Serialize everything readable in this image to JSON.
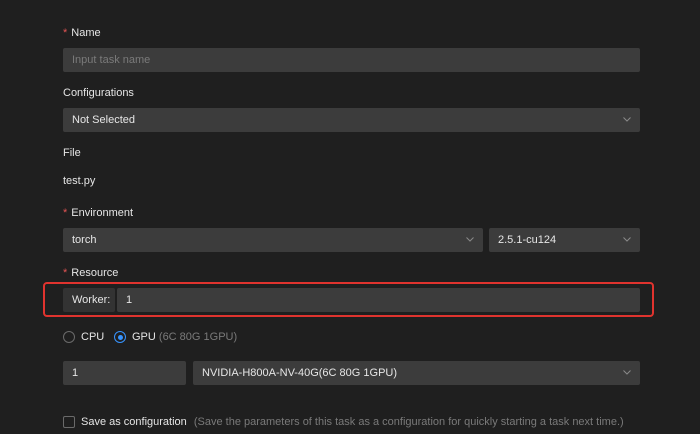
{
  "name": {
    "label": "Name",
    "placeholder": "Input task name"
  },
  "configurations": {
    "label": "Configurations",
    "value": "Not Selected"
  },
  "file": {
    "label": "File",
    "value": "test.py"
  },
  "environment": {
    "label": "Environment",
    "framework": "torch",
    "version": "2.5.1-cu124"
  },
  "resource": {
    "label": "Resource",
    "worker_label": "Worker:",
    "worker_value": "1",
    "cpu_label": "CPU",
    "gpu_label": "GPU",
    "gpu_spec": "(6C 80G 1GPU)",
    "count": "1",
    "gpu_model": "NVIDIA-H800A-NV-40G(6C 80G 1GPU)"
  },
  "save": {
    "label": "Save as configuration",
    "hint": "(Save the parameters of this task as a configuration for quickly starting a task next time.)"
  },
  "colors": {
    "accent": "#3794ff",
    "highlight": "#e0332e",
    "required": "#e35454"
  },
  "icons": [
    "chevron-down-icon"
  ]
}
